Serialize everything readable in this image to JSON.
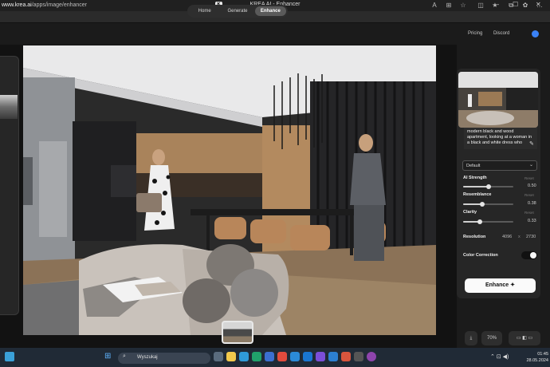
{
  "browser": {
    "title": "KREA AI - Enhancer",
    "url_domain": "www.krea.ai",
    "url_path": "/apps/image/enhancer"
  },
  "nav": {
    "tabs": [
      {
        "label": "Home",
        "active": false
      },
      {
        "label": "Generate",
        "active": false
      },
      {
        "label": "Enhance",
        "active": true
      }
    ],
    "pricing": "Pricing",
    "discord": "Discord"
  },
  "sidebar": {
    "prompt": "modern black and wood apartment, looking at a woman in a black and white dress who",
    "preset": "Default",
    "sliders": [
      {
        "label": "AI Strength",
        "value": "0.50",
        "reset": "Reset",
        "level": 0.5
      },
      {
        "label": "Resemblance",
        "value": "0.38",
        "reset": "Reset",
        "level": 0.38
      },
      {
        "label": "Clarity",
        "value": "0.33",
        "reset": "Reset",
        "level": 0.33
      }
    ],
    "resolution_label": "Resolution",
    "resolution_width": "4096",
    "resolution_x": "x",
    "resolution_height": "2730",
    "color_correction_label": "Color Correction",
    "color_correction_on": true,
    "enhance_label": "Enhance"
  },
  "bottom_bar": {
    "zoom": "70%"
  },
  "taskbar": {
    "search_label": "Wyszukaj",
    "time": "01:45",
    "date": "28.05.2024"
  }
}
